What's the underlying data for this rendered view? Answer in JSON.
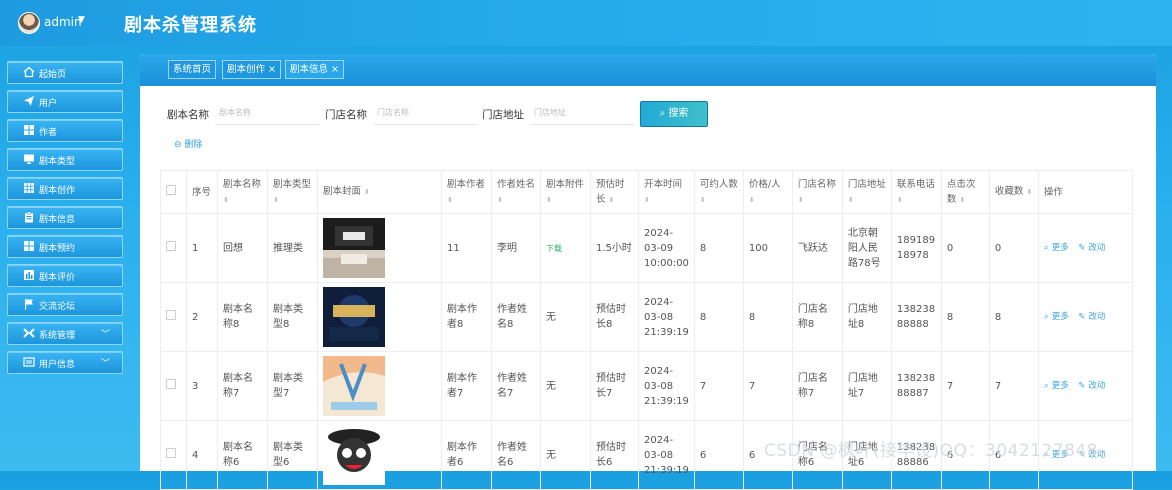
{
  "header": {
    "user": "admin",
    "title": "剧本杀管理系统"
  },
  "sidebar": {
    "items": [
      {
        "label": "起始页",
        "icon": "home-icon"
      },
      {
        "label": "用户",
        "icon": "send-icon"
      },
      {
        "label": "作者",
        "icon": "grid-icon"
      },
      {
        "label": "剧本类型",
        "icon": "monitor-icon"
      },
      {
        "label": "剧本创作",
        "icon": "apps-icon"
      },
      {
        "label": "剧本信息",
        "icon": "clipboard-icon"
      },
      {
        "label": "剧本预约",
        "icon": "grid-icon"
      },
      {
        "label": "剧本评价",
        "icon": "chart-icon"
      },
      {
        "label": "交流论坛",
        "icon": "flag-icon"
      },
      {
        "label": "系统管理",
        "icon": "tools-icon",
        "expandable": true
      },
      {
        "label": "用户信息",
        "icon": "card-icon",
        "expandable": true
      }
    ]
  },
  "tabs": [
    {
      "label": "系统首页"
    },
    {
      "label": "剧本创作 ×"
    },
    {
      "label": "剧本信息 ×"
    }
  ],
  "search": {
    "name_label": "剧本名称",
    "name_placeholder": "剧本名称",
    "store_label": "门店名称",
    "store_placeholder": "门店名称",
    "addr_label": "门店地址",
    "addr_placeholder": "门店地址",
    "search_button": "搜索",
    "delete_button": "删除"
  },
  "table": {
    "headers": [
      "序号",
      "剧本名称",
      "剧本类型",
      "剧本封面",
      "剧本作者",
      "作者姓名",
      "剧本附件",
      "预估时长",
      "开本时间",
      "可约人数",
      "价格/人",
      "门店名称",
      "门店地址",
      "联系电话",
      "点击次数",
      "收藏数",
      "操作"
    ],
    "more_label": "更多",
    "edit_label": "改动",
    "rows": [
      {
        "no": "1",
        "name": "回想",
        "type": "推理类",
        "author": "11",
        "author_name": "李明",
        "attachment": "下载",
        "duration": "1.5小时",
        "time": "2024-03-09 10:00:00",
        "capacity": "8",
        "price": "100",
        "store": "飞跃达",
        "address": "北京朝阳人民路78号",
        "phone": "18918918978",
        "clicks": "0",
        "favs": "0"
      },
      {
        "no": "2",
        "name": "剧本名称8",
        "type": "剧本类型8",
        "author": "剧本作者8",
        "author_name": "作者姓名8",
        "attachment": "无",
        "duration": "预估时长8",
        "time": "2024-03-08 21:39:19",
        "capacity": "8",
        "price": "8",
        "store": "门店名称8",
        "address": "门店地址8",
        "phone": "13823888888",
        "clicks": "8",
        "favs": "8"
      },
      {
        "no": "3",
        "name": "剧本名称7",
        "type": "剧本类型7",
        "author": "剧本作者7",
        "author_name": "作者姓名7",
        "attachment": "无",
        "duration": "预估时长7",
        "time": "2024-03-08 21:39:19",
        "capacity": "7",
        "price": "7",
        "store": "门店名称7",
        "address": "门店地址7",
        "phone": "13823888887",
        "clicks": "7",
        "favs": "7"
      },
      {
        "no": "4",
        "name": "剧本名称6",
        "type": "剧本类型6",
        "author": "剧本作者6",
        "author_name": "作者姓名6",
        "attachment": "无",
        "duration": "预估时长6",
        "time": "2024-03-08 21:39:19",
        "capacity": "6",
        "price": "6",
        "store": "门店名称6",
        "address": "门店地址6",
        "phone": "13823888886",
        "clicks": "6",
        "favs": "6"
      }
    ]
  },
  "watermark": "CSDN @枫叶(接毕设)QQ：3042127848"
}
